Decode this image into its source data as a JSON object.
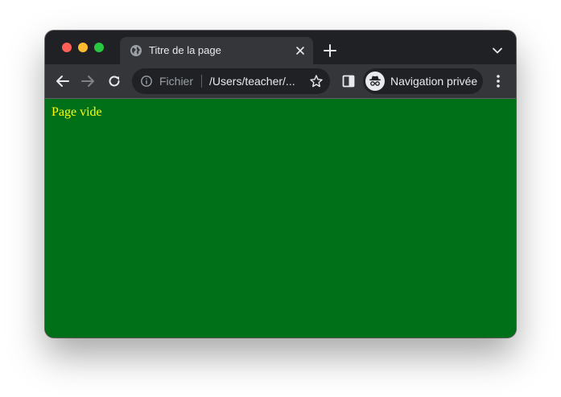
{
  "colors": {
    "page_background": "#007018",
    "page_text": "#ffff00",
    "chrome_dark": "#202124",
    "toolbar": "#35363a"
  },
  "tab": {
    "title": "Titre de la page",
    "icon": "globe-icon"
  },
  "address_bar": {
    "scheme_label": "Fichier",
    "url": "/Users/teacher/..."
  },
  "profile": {
    "label": "Navigation privée",
    "icon": "incognito-icon"
  },
  "page": {
    "text": "Page vide"
  }
}
